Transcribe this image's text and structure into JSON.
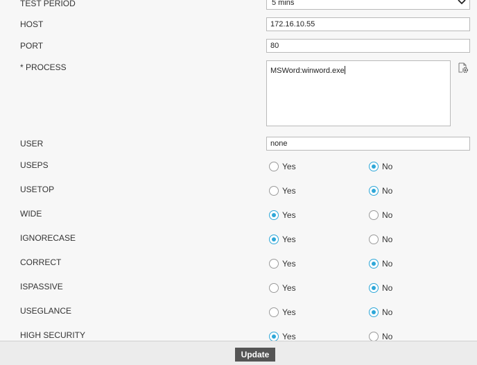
{
  "form": {
    "test_period": {
      "label": "TEST PERIOD",
      "value": "5 mins"
    },
    "host": {
      "label": "HOST",
      "value": "172.16.10.55"
    },
    "port": {
      "label": "PORT",
      "value": "80"
    },
    "process": {
      "label": "* PROCESS",
      "value": "MSWord:winword.exe"
    },
    "user": {
      "label": "USER",
      "value": "none"
    },
    "radios": [
      {
        "label": "USEPS",
        "yes": "Yes",
        "no": "No",
        "selected": "No"
      },
      {
        "label": "USETOP",
        "yes": "Yes",
        "no": "No",
        "selected": "No"
      },
      {
        "label": "WIDE",
        "yes": "Yes",
        "no": "No",
        "selected": "Yes"
      },
      {
        "label": "IGNORECASE",
        "yes": "Yes",
        "no": "No",
        "selected": "Yes"
      },
      {
        "label": "CORRECT",
        "yes": "Yes",
        "no": "No",
        "selected": "No"
      },
      {
        "label": "ISPASSIVE",
        "yes": "Yes",
        "no": "No",
        "selected": "No"
      },
      {
        "label": "USEGLANCE",
        "yes": "Yes",
        "no": "No",
        "selected": "No"
      },
      {
        "label": "HIGH SECURITY",
        "yes": "Yes",
        "no": "No",
        "selected": "Yes"
      }
    ]
  },
  "footer": {
    "update_label": "Update"
  },
  "icons": {
    "select_arrow": "chevron-down-icon",
    "process_settings": "gear-icon"
  },
  "colors": {
    "radio_selected": "#2ea7d8",
    "button_bg": "#555555"
  }
}
